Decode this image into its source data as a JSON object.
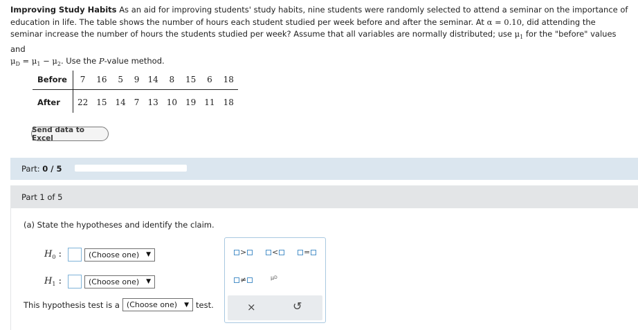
{
  "problem": {
    "title": "Improving Study Habits",
    "text_1": "As an aid for improving students' study habits, nine students were randomly selected to attend a seminar on the importance of education in life. The table shows the number of hours each student studied per week before and after the seminar. At",
    "alpha_expr": "α = 0.10",
    "text_2": ", did attending the seminar increase the number of hours the students studied per week? Assume that all variables are normally distributed; use",
    "mu1": "μ",
    "mu1_sub": "1",
    "text_3": " for the \"before\" values and",
    "mud": "μ",
    "mud_sub": "D",
    "mud_eq": " = μ",
    "mud_eq_sub1": "1",
    "mud_minus": " − μ",
    "mud_eq_sub2": "2",
    "text_4": ". Use the",
    "pvalue_italic": "P",
    "text_5": "-value method."
  },
  "table": {
    "before_label": "Before",
    "after_label": "After",
    "before": [
      "7",
      "16",
      "5",
      "9",
      "14",
      "8",
      "15",
      "6",
      "18"
    ],
    "after": [
      "22",
      "15",
      "14",
      "7",
      "13",
      "10",
      "19",
      "11",
      "18"
    ]
  },
  "excel_button": "Send data to Excel",
  "part_bar": {
    "prefix": "Part: ",
    "value": "0 / 5",
    "progress": 0
  },
  "part_head": "Part 1 of 5",
  "question": "(a) State the hypotheses and identify the claim.",
  "h0": {
    "label": "H",
    "sub": "0",
    "colon": ":",
    "select": "(Choose one)"
  },
  "h1": {
    "label": "H",
    "sub": "1",
    "colon": ":",
    "select": "(Choose one)"
  },
  "test": {
    "prefix": "This hypothesis test is a",
    "select": "(Choose one)",
    "suffix": "test."
  },
  "palette": {
    "gt": ">",
    "lt": "<",
    "eq": "=",
    "neq": "≠",
    "mud": "μ",
    "mud_sub": "D",
    "clear": "×",
    "undo": "↺"
  },
  "colors": {
    "part_bar_bg": "#dbe6ef",
    "part_head_bg": "#e3e5e7",
    "accent": "#4a90c8"
  }
}
